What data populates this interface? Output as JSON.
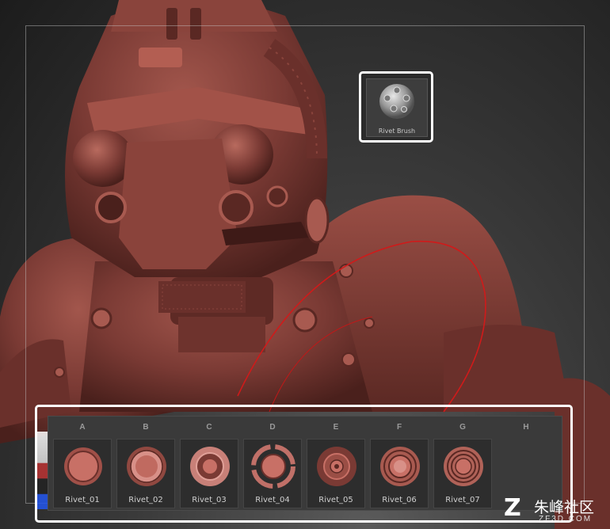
{
  "colors": {
    "model": "#7a3a34",
    "model_highlight": "#a85a50",
    "model_shadow": "#3e1a17",
    "stroke_line": "#d01a1a",
    "highlight_frame": "#ffffff"
  },
  "brush_thumbnail": {
    "label": "Rivet Brush",
    "icon": "rivet-sphere-icon"
  },
  "palette": {
    "slots": [
      {
        "key": "A",
        "label": "Rivet_01",
        "icon": "rivet-plain-icon"
      },
      {
        "key": "B",
        "label": "Rivet_02",
        "icon": "rivet-rim-icon"
      },
      {
        "key": "C",
        "label": "Rivet_03",
        "icon": "rivet-domed-icon"
      },
      {
        "key": "D",
        "label": "Rivet_04",
        "icon": "rivet-split-ring-icon"
      },
      {
        "key": "E",
        "label": "Rivet_05",
        "icon": "rivet-cone-icon"
      },
      {
        "key": "F",
        "label": "Rivet_06",
        "icon": "rivet-grooved-icon"
      },
      {
        "key": "G",
        "label": "Rivet_07",
        "icon": "rivet-double-ring-icon"
      },
      {
        "key": "H",
        "label": "",
        "icon": ""
      }
    ]
  },
  "watermark": {
    "logo": "Z",
    "text": "朱峰社区",
    "sub": "ZF3D.COM"
  }
}
